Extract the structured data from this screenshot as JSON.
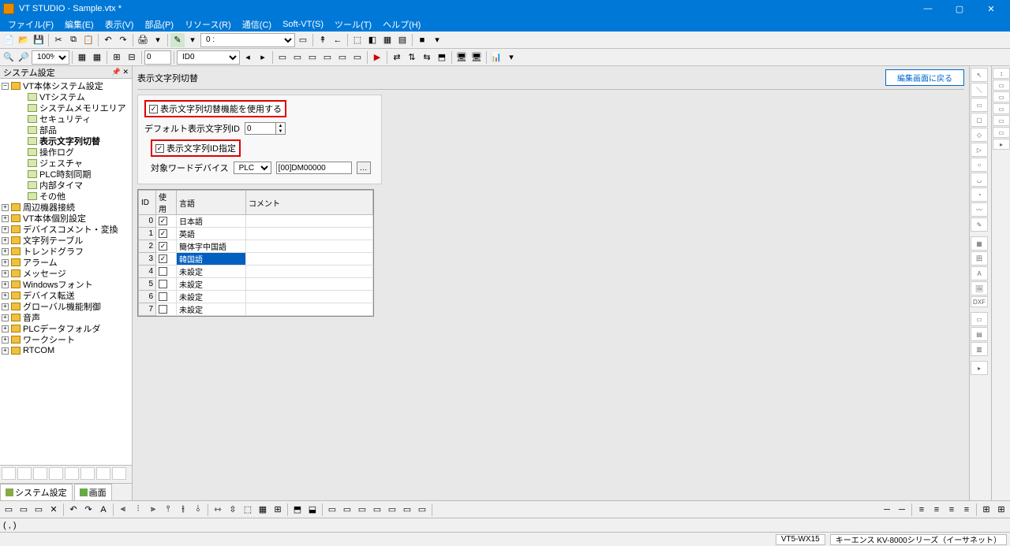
{
  "title": "VT STUDIO - Sample.vtx *",
  "menus": [
    "ファイル(F)",
    "編集(E)",
    "表示(V)",
    "部品(P)",
    "リソース(R)",
    "通信(C)",
    "Soft-VT(S)",
    "ツール(T)",
    "ヘルプ(H)"
  ],
  "toolbar1": {
    "combo1": "   0 :"
  },
  "toolbar2": {
    "zoom": "100%",
    "spin": "0",
    "idcombo": "ID0"
  },
  "sidebar": {
    "header": "システム設定",
    "root": "VT本体システム設定",
    "items": [
      {
        "lbl": "VTシステム",
        "icon": "file",
        "indent": 2
      },
      {
        "lbl": "システムメモリエリア",
        "icon": "file",
        "indent": 2
      },
      {
        "lbl": "セキュリティ",
        "icon": "file",
        "indent": 2
      },
      {
        "lbl": "部品",
        "icon": "file",
        "indent": 2
      },
      {
        "lbl": "表示文字列切替",
        "icon": "file",
        "indent": 2,
        "bold": true
      },
      {
        "lbl": "操作ログ",
        "icon": "file",
        "indent": 2
      },
      {
        "lbl": "ジェスチャ",
        "icon": "file",
        "indent": 2
      },
      {
        "lbl": "PLC時刻同期",
        "icon": "file",
        "indent": 2
      },
      {
        "lbl": "内部タイマ",
        "icon": "file",
        "indent": 2
      },
      {
        "lbl": "その他",
        "icon": "file",
        "indent": 2
      }
    ],
    "folders": [
      "周辺機器接続",
      "VT本体個別設定",
      "デバイスコメント・変換",
      "文字列テーブル",
      "トレンドグラフ",
      "アラーム",
      "メッセージ",
      "Windowsフォント",
      "デバイス転送",
      "グローバル機能制御",
      "音声",
      "PLCデータフォルダ",
      "ワークシート",
      "RTCOM"
    ],
    "tabs": [
      "システム設定",
      "画面"
    ]
  },
  "panel": {
    "title": "表示文字列切替",
    "back_btn": "編集画面に戻る",
    "chk1": "表示文字列切替機能を使用する",
    "default_lbl": "デフォルト表示文字列ID",
    "default_val": "0",
    "chk2": "表示文字列ID指定",
    "target_lbl": "対象ワードデバイス",
    "plc_sel": "PLC",
    "dev_val": "[00]DM00000",
    "cols": [
      "ID",
      "使用",
      "言語",
      "コメント"
    ],
    "rows": [
      {
        "id": "0",
        "use": true,
        "lang": "日本語",
        "cmt": ""
      },
      {
        "id": "1",
        "use": true,
        "lang": "英語",
        "cmt": ""
      },
      {
        "id": "2",
        "use": true,
        "lang": "簡体字中国語",
        "cmt": ""
      },
      {
        "id": "3",
        "use": true,
        "lang": "韓国語",
        "cmt": "",
        "sel": true
      },
      {
        "id": "4",
        "use": false,
        "lang": "未設定",
        "cmt": ""
      },
      {
        "id": "5",
        "use": false,
        "lang": "未設定",
        "cmt": ""
      },
      {
        "id": "6",
        "use": false,
        "lang": "未設定",
        "cmt": ""
      },
      {
        "id": "7",
        "use": false,
        "lang": "未設定",
        "cmt": ""
      }
    ]
  },
  "bottombar2": {
    "coord": "(    ,    )"
  },
  "status": {
    "model": "VT5-WX15",
    "plc": "キーエンス KV-8000シリーズ（イーサネット）"
  }
}
